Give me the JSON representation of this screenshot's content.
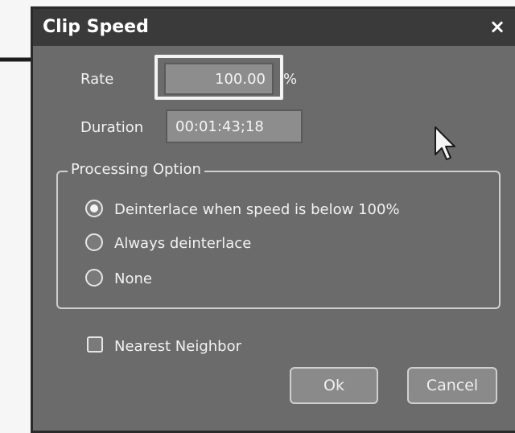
{
  "dialog": {
    "title": "Clip Speed",
    "close_label": "×"
  },
  "rate": {
    "label": "Rate",
    "value": "100.00",
    "unit": "%"
  },
  "duration": {
    "label": "Duration",
    "value": "00:01:43;18"
  },
  "processing": {
    "legend": "Processing Option",
    "options": [
      {
        "label": "Deinterlace when speed is below 100%",
        "selected": true
      },
      {
        "label": "Always deinterlace",
        "selected": false
      },
      {
        "label": "None",
        "selected": false
      }
    ]
  },
  "nearest_neighbor": {
    "label": "Nearest Neighbor",
    "checked": false
  },
  "buttons": {
    "ok": "Ok",
    "cancel": "Cancel"
  },
  "icons": {
    "close": "close-icon",
    "cursor": "mouse-cursor-icon",
    "annotation": "arrow-right-icon"
  },
  "colors": {
    "dialog_bg": "#6b6b6b",
    "titlebar_bg": "#3a3a3a"
  }
}
